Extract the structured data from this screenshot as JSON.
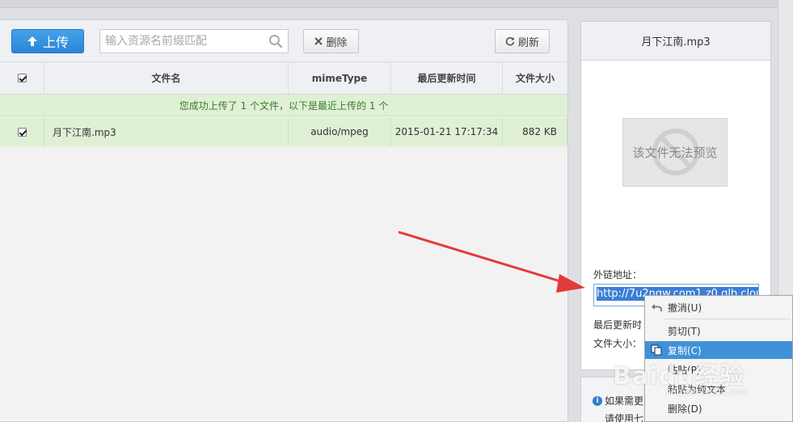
{
  "toolbar": {
    "upload_label": "上传",
    "search_placeholder": "输入资源名前缀匹配",
    "delete_label": "删除",
    "refresh_label": "刷新"
  },
  "table": {
    "headers": [
      "文件名",
      "mimeType",
      "最后更新时间",
      "文件大小"
    ],
    "header_checkbox_checked": true,
    "notice": "您成功上传了 1 个文件，以下是最近上传的 1 个",
    "rows": [
      {
        "checked": true,
        "name": "月下江南.mp3",
        "mime": "audio/mpeg",
        "updated": "2015-01-21 17:17:34",
        "size": "882 KB"
      }
    ]
  },
  "detail": {
    "title": "月下江南.mp3",
    "preview_text": "该文件无法预览",
    "link_label": "外链地址：",
    "link_value": "http://7u2nqw.com1.z0.glb.clou",
    "updated_label": "最后更新时",
    "size_label": "文件大小："
  },
  "help": {
    "line1": "如果需更",
    "line2": "请使用七"
  },
  "context_menu": {
    "items": [
      {
        "label": "撤消(U)",
        "icon": "undo-icon"
      },
      {
        "label": "剪切(T)",
        "icon": ""
      },
      {
        "label": "复制(C)",
        "icon": "copy-icon",
        "highlighted": true
      },
      {
        "label": "粘贴(P)",
        "icon": ""
      },
      {
        "label": "粘贴为纯文本",
        "icon": ""
      },
      {
        "label": "删除(D)",
        "icon": ""
      }
    ]
  },
  "watermark": {
    "brand": "Baidu经验",
    "url": "jingyan.baidu.com"
  },
  "colors": {
    "accent": "#2a86d6",
    "success_bg": "#dff0d5",
    "menu_highlight": "#3f92d8",
    "annotation_arrow": "#e23b3b"
  }
}
